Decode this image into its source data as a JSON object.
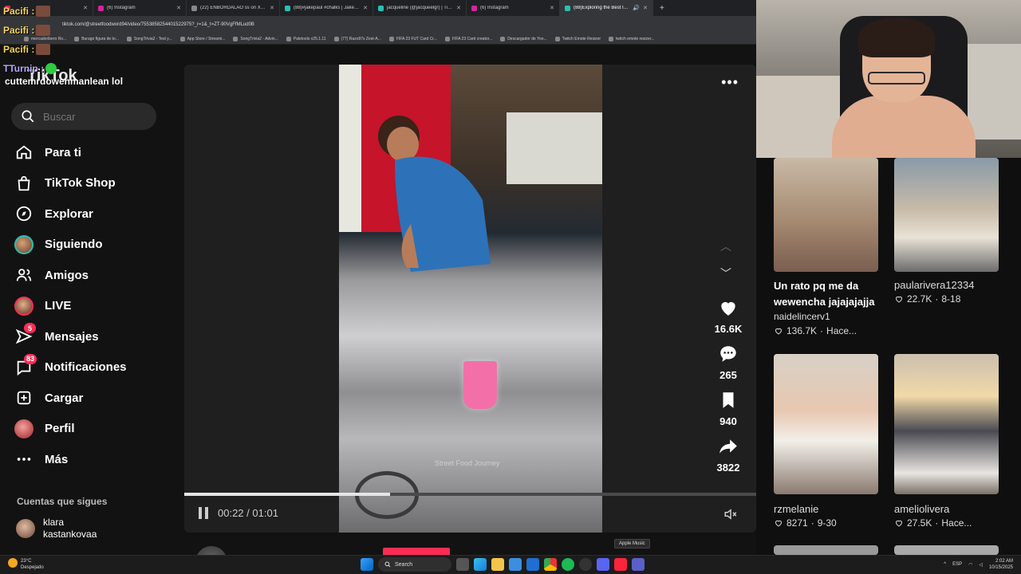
{
  "browser": {
    "tabs": [
      {
        "title": "",
        "color": "#e0245e",
        "active": false
      },
      {
        "title": "(6) Instagram",
        "color": "#d6249f",
        "active": false
      },
      {
        "title": "(22) ENBORDALAO ss on X: \"C...",
        "color": "#333333",
        "active": false
      },
      {
        "title": "(88)#jakepaul #chalks | Jakepa...",
        "color": "#111111",
        "active": false
      },
      {
        "title": "jacqueline (@jacqueelgr) | TikT...",
        "color": "#111111",
        "active": false
      },
      {
        "title": "(6) Instagram",
        "color": "#d6249f",
        "active": false
      },
      {
        "title": "(88)Exploring the Best Indi...",
        "color": "#111111",
        "active": true
      }
    ],
    "url": "tiktok.com/@streetfoodword94/video/7553858254401522975?_r=1&_t=ZT-90VgFfMLud0B",
    "bookmarks": [
      "mercadoribero Ro...",
      "Burago figura de to...",
      "SongTrivia2 - Test y...",
      "App Store / Streami...",
      "SongTrivia2 - Advin...",
      "Paletools v25.1.11",
      "(77) Razo97s Zest-A...",
      "FIFA 23 FUT Card Cr...",
      "FIFA 23 Card creator...",
      "Descargador de Yoo...",
      "Twitch Emote Resizer",
      "twitch emote resizer..."
    ]
  },
  "overlay": {
    "chat_lines": [
      "Pacifi :",
      "Pacifi :",
      "Pacifi :"
    ],
    "chat_user": "TTurnip :",
    "tiktok_logo": "TikTok",
    "chat_message": "cuttemrdowenmanlean lol"
  },
  "sidebar": {
    "search_placeholder": "Buscar",
    "nav": [
      {
        "label": "Para ti",
        "icon": "home-icon",
        "badge": ""
      },
      {
        "label": "TikTok Shop",
        "icon": "shop-icon",
        "badge": ""
      },
      {
        "label": "Explorar",
        "icon": "compass-icon",
        "badge": ""
      },
      {
        "label": "Siguiendo",
        "icon": "following-avatar",
        "badge": ""
      },
      {
        "label": "Amigos",
        "icon": "friends-icon",
        "badge": ""
      },
      {
        "label": "LIVE",
        "icon": "live-avatar",
        "badge": ""
      },
      {
        "label": "Mensajes",
        "icon": "messages-icon",
        "badge": "5"
      },
      {
        "label": "Notificaciones",
        "icon": "notifications-icon",
        "badge": "83"
      },
      {
        "label": "Cargar",
        "icon": "upload-icon",
        "badge": ""
      },
      {
        "label": "Perfil",
        "icon": "profile-avatar",
        "badge": ""
      },
      {
        "label": "Más",
        "icon": "more-icon",
        "badge": ""
      }
    ],
    "following_title": "Cuentas que sigues",
    "following": [
      {
        "name": "klara",
        "handle": "kastankovaa"
      }
    ]
  },
  "video": {
    "watermark": "Street Food Journey",
    "time_current": "00:22",
    "time_total": "01:01",
    "progress": 0.36,
    "likes": "16.6K",
    "comments": "265",
    "saves": "940",
    "shares": "3822",
    "creator": "streetfoodword94"
  },
  "feed": [
    {
      "caption": "Un rato pq me da wewencha jajajajajja",
      "user": "naidelincerv1",
      "likes": "136.7K",
      "date": "Hace..."
    },
    {
      "caption": "",
      "user": "paularivera12334",
      "likes": "22.7K",
      "date": "8-18"
    },
    {
      "caption": "",
      "user": "rzmelanie",
      "likes": "8271",
      "date": "9-30"
    },
    {
      "caption": "",
      "user": "ameliolivera",
      "likes": "27.5K",
      "date": "Hace..."
    }
  ],
  "taskbar": {
    "weather_temp": "23°C",
    "weather_desc": "Despejado",
    "search": "Search",
    "tooltip": "Apple Music",
    "lang": "ESP",
    "time": "2:02 AM",
    "date": "10/15/2025"
  },
  "colors": {
    "accent": "#fe2c55",
    "teal": "#25c2b5"
  }
}
